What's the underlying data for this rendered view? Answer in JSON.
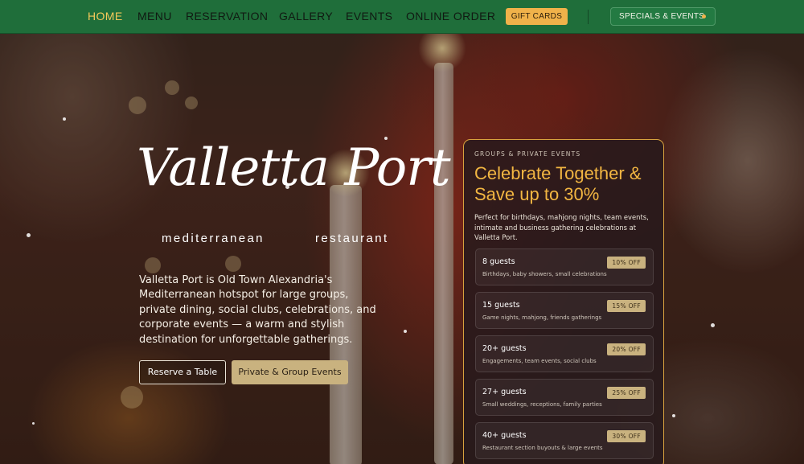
{
  "nav": {
    "links": [
      "HOME",
      "MENU",
      "RESERVATION",
      "GALLERY",
      "EVENTS",
      "ONLINE ORDER"
    ],
    "gift_cards": "GIFT CARDS",
    "specials": "SPECIALS & EVENTS"
  },
  "logo": {
    "script": "Valletta Port",
    "sub_left": "mediterranean",
    "sub_right": "restaurant"
  },
  "hero": {
    "description": "Valletta Port is Old Town Alexandria's Mediterranean hotspot for large groups, private dining, social clubs, celebrations, and corporate events — a warm and stylish destination for unforgettable gatherings.",
    "reserve_button": "Reserve a Table",
    "private_button": "Private & Group Events"
  },
  "promo": {
    "eyebrow": "GROUPS & PRIVATE EVENTS",
    "title": "Celebrate Together & Save up to 30%",
    "body": "Perfect for birthdays, mahjong nights, team events, intimate and business gathering celebrations at Valletta Port.",
    "tiers": [
      {
        "guests": "8 guests",
        "desc": "Birthdays, baby showers, small celebrations",
        "badge": "10% OFF"
      },
      {
        "guests": "15 guests",
        "desc": "Game nights, mahjong, friends gatherings",
        "badge": "15% OFF"
      },
      {
        "guests": "20+ guests",
        "desc": "Engagements, team events, social clubs",
        "badge": "20% OFF"
      },
      {
        "guests": "27+ guests",
        "desc": "Small weddings, receptions, family parties",
        "badge": "25% OFF"
      },
      {
        "guests": "40+ guests",
        "desc": "Restaurant section buyouts & large events",
        "badge": "30% OFF"
      }
    ]
  },
  "colors": {
    "nav_bg": "#1f6e3a",
    "accent_gold": "#f2b642",
    "badge_gold": "#c9b27f",
    "card_border": "#d8a23e"
  }
}
